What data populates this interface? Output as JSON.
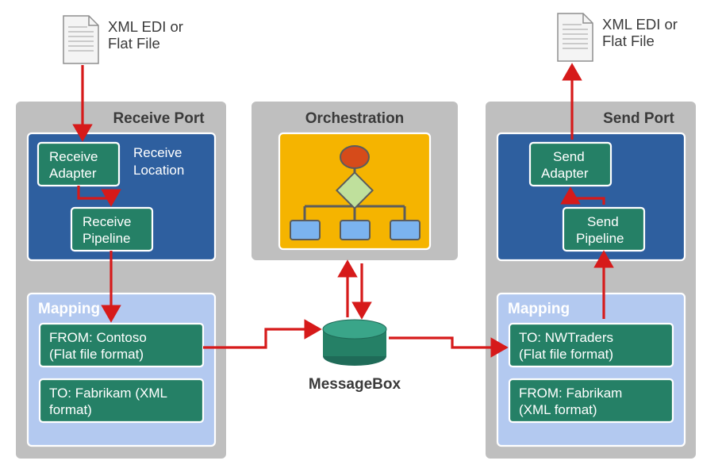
{
  "leftDoc": {
    "l1": "XML EDI or",
    "l2": "Flat File"
  },
  "rightDoc": {
    "l1": "XML EDI or",
    "l2": "Flat File"
  },
  "receivePort": {
    "title": "Receive Port",
    "location": {
      "l1": "Receive",
      "l2": "Location"
    },
    "adapter": {
      "l1": "Receive",
      "l2": "Adapter"
    },
    "pipeline": {
      "l1": "Receive",
      "l2": "Pipeline"
    },
    "mapping": {
      "title": "Mapping",
      "from": {
        "l1": "FROM: Contoso",
        "l2": "(Flat file format)"
      },
      "to": {
        "l1": "TO: Fabrikam (XML",
        "l2": "format)"
      }
    }
  },
  "orchestration": {
    "title": "Orchestration"
  },
  "messageBox": "MessageBox",
  "sendPort": {
    "title": "Send Port",
    "adapter": {
      "l1": "Send",
      "l2": "Adapter"
    },
    "pipeline": {
      "l1": "Send",
      "l2": "Pipeline"
    },
    "mapping": {
      "title": "Mapping",
      "to": {
        "l1": "TO: NWTraders",
        "l2": "(Flat file format)"
      },
      "from": {
        "l1": "FROM: Fabrikam",
        "l2": "(XML format)"
      }
    }
  }
}
